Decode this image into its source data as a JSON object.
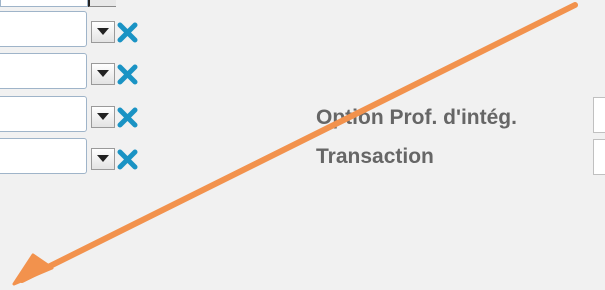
{
  "form": {
    "rows": [
      {
        "clear_icon": "close-icon"
      },
      {
        "clear_icon": "close-icon"
      },
      {
        "clear_icon": "close-icon"
      },
      {
        "clear_icon": "close-icon"
      }
    ],
    "option_label": "Option Prof. d'intég.",
    "transaction_label": "Transaction"
  },
  "annotation": {
    "arrow_color": "#f2924d",
    "clear_icon_color": "#1a93c4"
  }
}
